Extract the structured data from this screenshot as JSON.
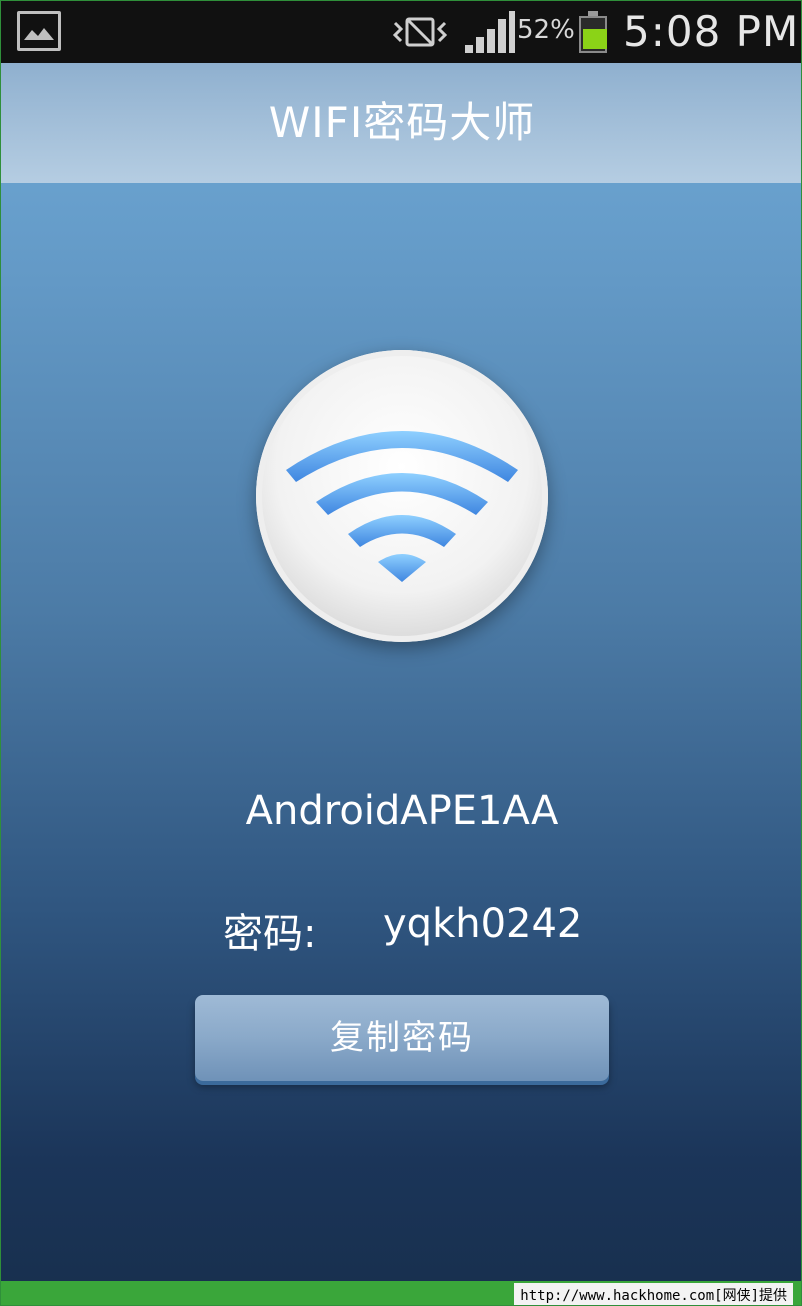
{
  "status_bar": {
    "battery_percent": "52%",
    "time": "5:08 PM"
  },
  "app": {
    "title": "WIFI密码大师",
    "network_name": "AndroidAPE1AA",
    "password_label": "密码:",
    "password_value": "yqkh0242",
    "copy_button_label": "复制密码"
  },
  "footer": {
    "watermark": "http://www.hackhome.com[网侠]提供"
  },
  "colors": {
    "battery_fill": "#8bd317",
    "accent_blue": "#5aa0e6"
  }
}
